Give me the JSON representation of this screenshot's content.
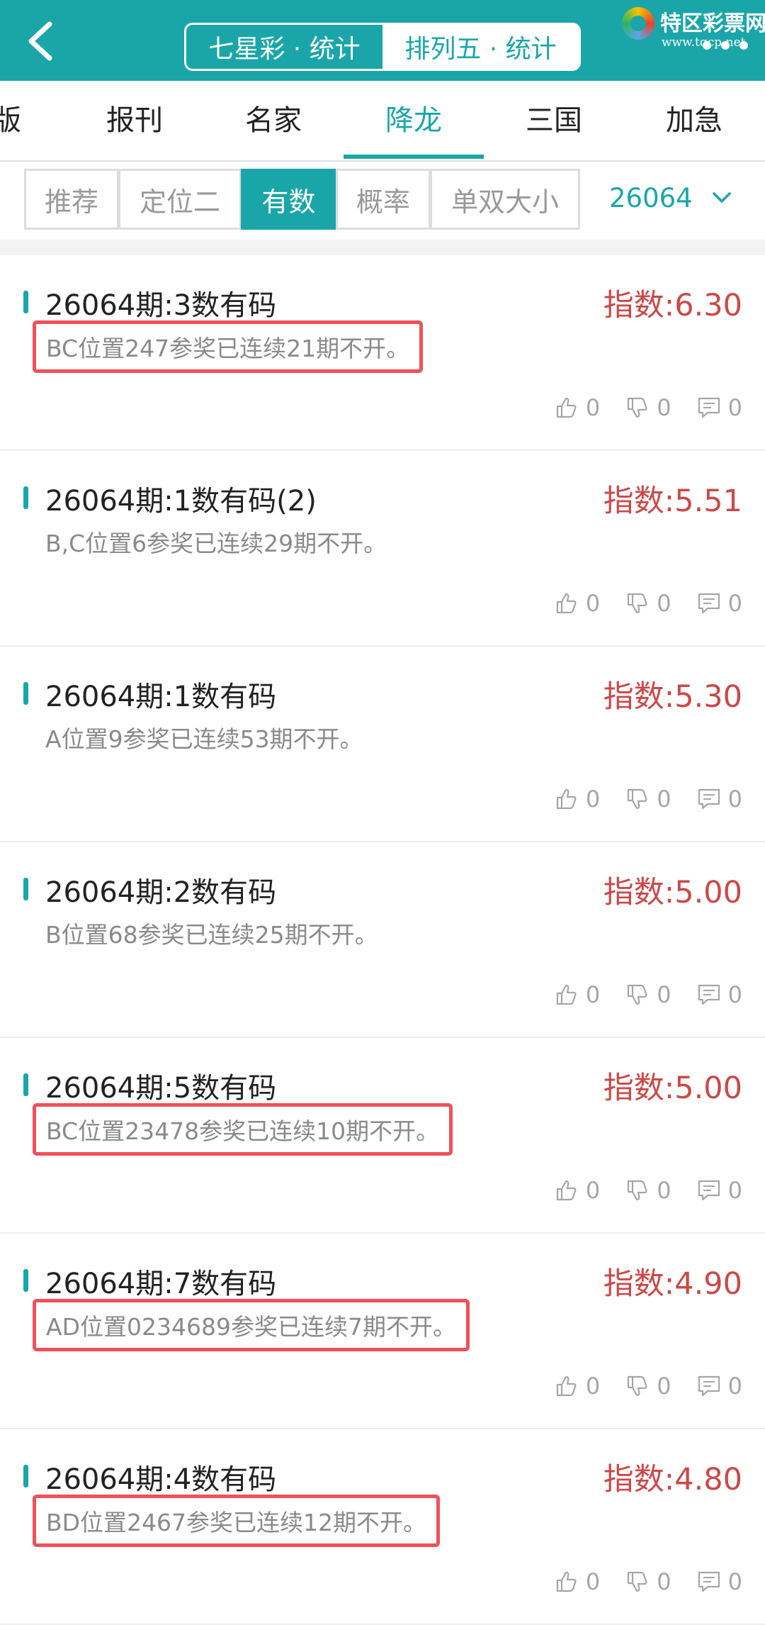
{
  "header": {
    "segments": [
      {
        "label": "七星彩 · 统计",
        "active": false
      },
      {
        "label": "排列五 · 统计",
        "active": true
      }
    ],
    "logo_text": "特区彩票网",
    "logo_url": "www.tqcp.net",
    "accent_color": "#1aa6a9"
  },
  "nav": {
    "tabs": [
      "版",
      "报刊",
      "名家",
      "降龙",
      "三国",
      "加急"
    ],
    "active_index": 3
  },
  "filters": {
    "buttons": [
      "推荐",
      "定位二",
      "有数",
      "概率",
      "单双大小"
    ],
    "active_index": 2,
    "issue": "26064"
  },
  "items": [
    {
      "title": "26064期:3数有码",
      "score": "指数:6.30",
      "desc": "BC位置247参奖已连续21期不开。",
      "highlighted": true,
      "likes": "0",
      "dislikes": "0",
      "comments": "0"
    },
    {
      "title": "26064期:1数有码(2)",
      "score": "指数:5.51",
      "desc": "B,C位置6参奖已连续29期不开。",
      "highlighted": false,
      "likes": "0",
      "dislikes": "0",
      "comments": "0"
    },
    {
      "title": "26064期:1数有码",
      "score": "指数:5.30",
      "desc": "A位置9参奖已连续53期不开。",
      "highlighted": false,
      "likes": "0",
      "dislikes": "0",
      "comments": "0"
    },
    {
      "title": "26064期:2数有码",
      "score": "指数:5.00",
      "desc": "B位置68参奖已连续25期不开。",
      "highlighted": false,
      "likes": "0",
      "dislikes": "0",
      "comments": "0"
    },
    {
      "title": "26064期:5数有码",
      "score": "指数:5.00",
      "desc": "BC位置23478参奖已连续10期不开。",
      "highlighted": true,
      "likes": "0",
      "dislikes": "0",
      "comments": "0"
    },
    {
      "title": "26064期:7数有码",
      "score": "指数:4.90",
      "desc": "AD位置0234689参奖已连续7期不开。",
      "highlighted": true,
      "likes": "0",
      "dislikes": "0",
      "comments": "0"
    },
    {
      "title": "26064期:4数有码",
      "score": "指数:4.80",
      "desc": "BD位置2467参奖已连续12期不开。",
      "highlighted": true,
      "likes": "0",
      "dislikes": "0",
      "comments": "0"
    }
  ]
}
